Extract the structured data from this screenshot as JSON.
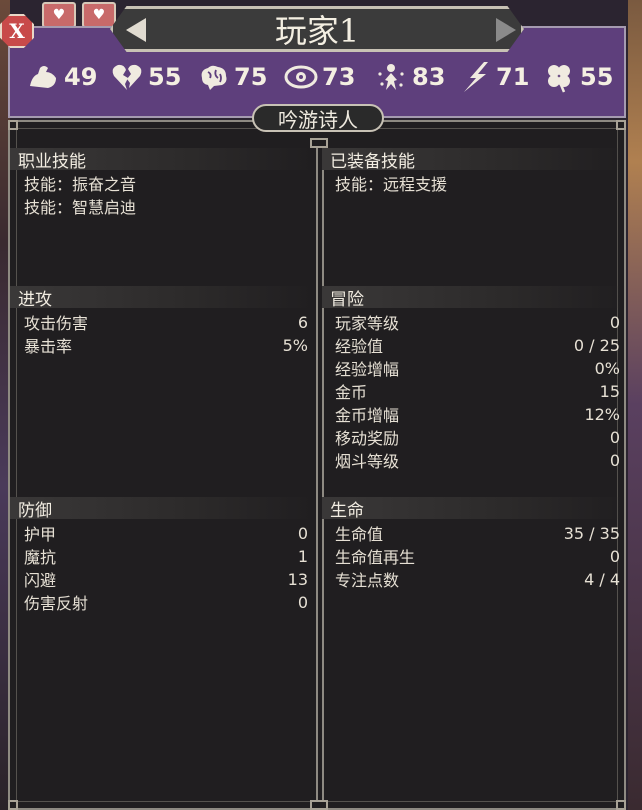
{
  "window": {
    "close_label": "X",
    "player_title": "玩家1",
    "class_name": "吟游诗人"
  },
  "header_stats": [
    {
      "icon": "strength-arm-icon",
      "value": "49"
    },
    {
      "icon": "broken-heart-icon",
      "value": "55"
    },
    {
      "icon": "brain-icon",
      "value": "75"
    },
    {
      "icon": "eye-icon",
      "value": "73"
    },
    {
      "icon": "spirit-figure-icon",
      "value": "83"
    },
    {
      "icon": "lightning-runner-icon",
      "value": "71"
    },
    {
      "icon": "clover-icon",
      "value": "55"
    }
  ],
  "left": {
    "class_skills": {
      "title": "职业技能",
      "items": [
        "技能：振奋之音",
        "技能：智慧启迪"
      ]
    },
    "offense": {
      "title": "进攻",
      "rows": [
        {
          "label": "攻击伤害",
          "value": "6"
        },
        {
          "label": "暴击率",
          "value": "5%"
        }
      ]
    },
    "defense": {
      "title": "防御",
      "rows": [
        {
          "label": "护甲",
          "value": "0"
        },
        {
          "label": "魔抗",
          "value": "1"
        },
        {
          "label": "闪避",
          "value": "13"
        },
        {
          "label": "伤害反射",
          "value": "0"
        }
      ]
    }
  },
  "right": {
    "equipped_skills": {
      "title": "已装备技能",
      "items": [
        "技能：远程支援"
      ]
    },
    "adventure": {
      "title": "冒险",
      "rows": [
        {
          "label": "玩家等级",
          "value": "0"
        },
        {
          "label": "经验值",
          "value": "0 / 25"
        },
        {
          "label": "经验增幅",
          "value": "0%"
        },
        {
          "label": "金币",
          "value": "15"
        },
        {
          "label": "金币增幅",
          "value": "12%"
        },
        {
          "label": "移动奖励",
          "value": "0"
        },
        {
          "label": "烟斗等级",
          "value": "0"
        }
      ]
    },
    "life": {
      "title": "生命",
      "rows": [
        {
          "label": "生命值",
          "value": "35 / 35"
        },
        {
          "label": "生命值再生",
          "value": "0"
        },
        {
          "label": "专注点数",
          "value": "4 / 4"
        }
      ]
    }
  },
  "colors": {
    "header_purple": "#5e3f7c",
    "panel_bg": "#201e20",
    "close_red": "#c84a4a",
    "heart_slot": "#c86a6a"
  }
}
